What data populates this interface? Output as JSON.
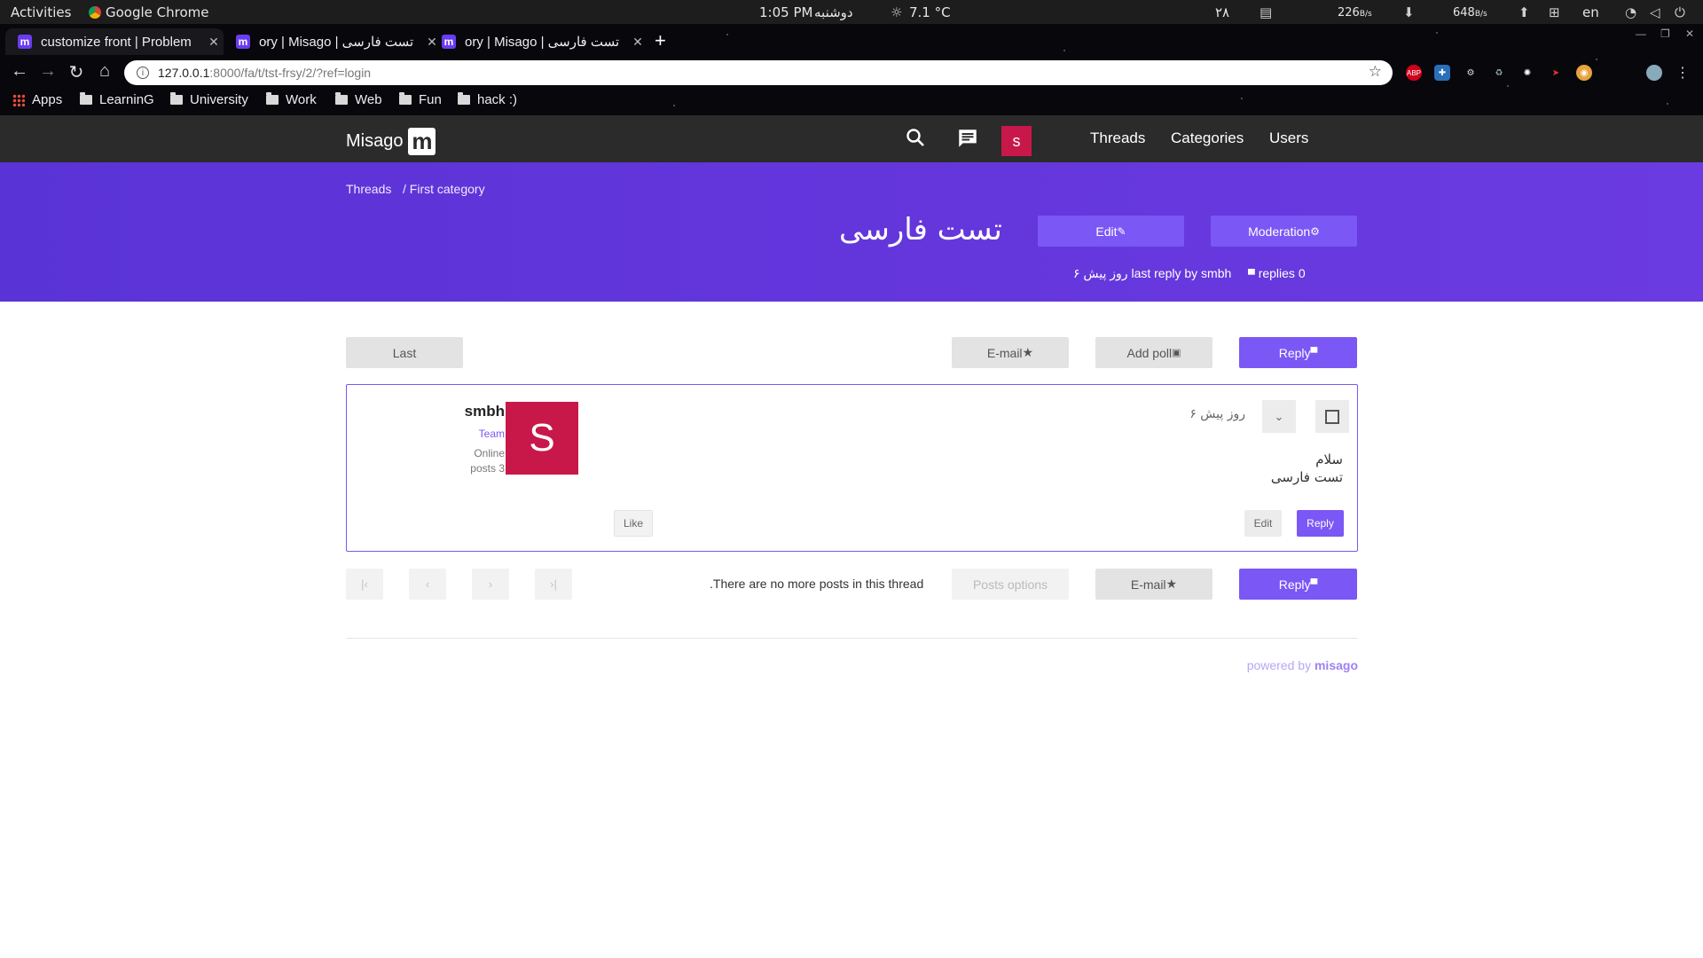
{
  "os_bar": {
    "activities": "Activities",
    "app": "Google Chrome",
    "time": "1:05 PM",
    "day": "دوشنبه",
    "weather": "7.1 °C",
    "date_num": "۲۸",
    "net_down": "226",
    "net_up": "648",
    "net_unit": "B/s",
    "lang": "en"
  },
  "browser": {
    "tabs": [
      {
        "title": "customize front | Problem",
        "active": true
      },
      {
        "title": "ory | Misago | تست فارسی",
        "active": false
      },
      {
        "title": "ory | Misago | تست فارسی",
        "active": false
      }
    ],
    "url_host": "127.0.0.1",
    "url_path": ":8000/fa/t/tst-frsy/2/?ref=login",
    "bookmarks": [
      "Apps",
      "LearninG",
      "University",
      "Work",
      "Web",
      "Fun",
      "hack :)"
    ]
  },
  "navbar": {
    "brand": "Misago",
    "brand_logo": "m",
    "user_initial": "s",
    "links": [
      "Threads",
      "Categories",
      "Users"
    ]
  },
  "thread": {
    "crumbs": [
      "Threads",
      "/ First category"
    ],
    "title": "تست فارسی",
    "edit_label": "Edit",
    "moderation_label": "Moderation",
    "last_reply": "۶ روز پیش last reply by smbh",
    "replies": "replies 0"
  },
  "toolbar_top": {
    "last": "Last",
    "email": "E-mail",
    "add_poll": "Add poll",
    "reply": "Reply"
  },
  "post": {
    "date": "۶ روز پیش",
    "body_lines": [
      "سلام",
      "تست فارسی"
    ],
    "author": "smbh",
    "rank": "Team",
    "status": "Online",
    "posts": "posts 3",
    "avatar_initial": "S",
    "like": "Like",
    "edit": "Edit",
    "reply": "Reply"
  },
  "toolbar_bottom": {
    "no_more": ".There are no more posts in this thread",
    "posts_options": "Posts options",
    "email": "E-mail",
    "reply": "Reply"
  },
  "footer": {
    "powered_by": "powered by",
    "misago": "misago"
  },
  "colors": {
    "accent": "#7b57f5",
    "hero": "#6336dc",
    "avatar": "#c8184a",
    "navbar": "#2b2b2b"
  }
}
